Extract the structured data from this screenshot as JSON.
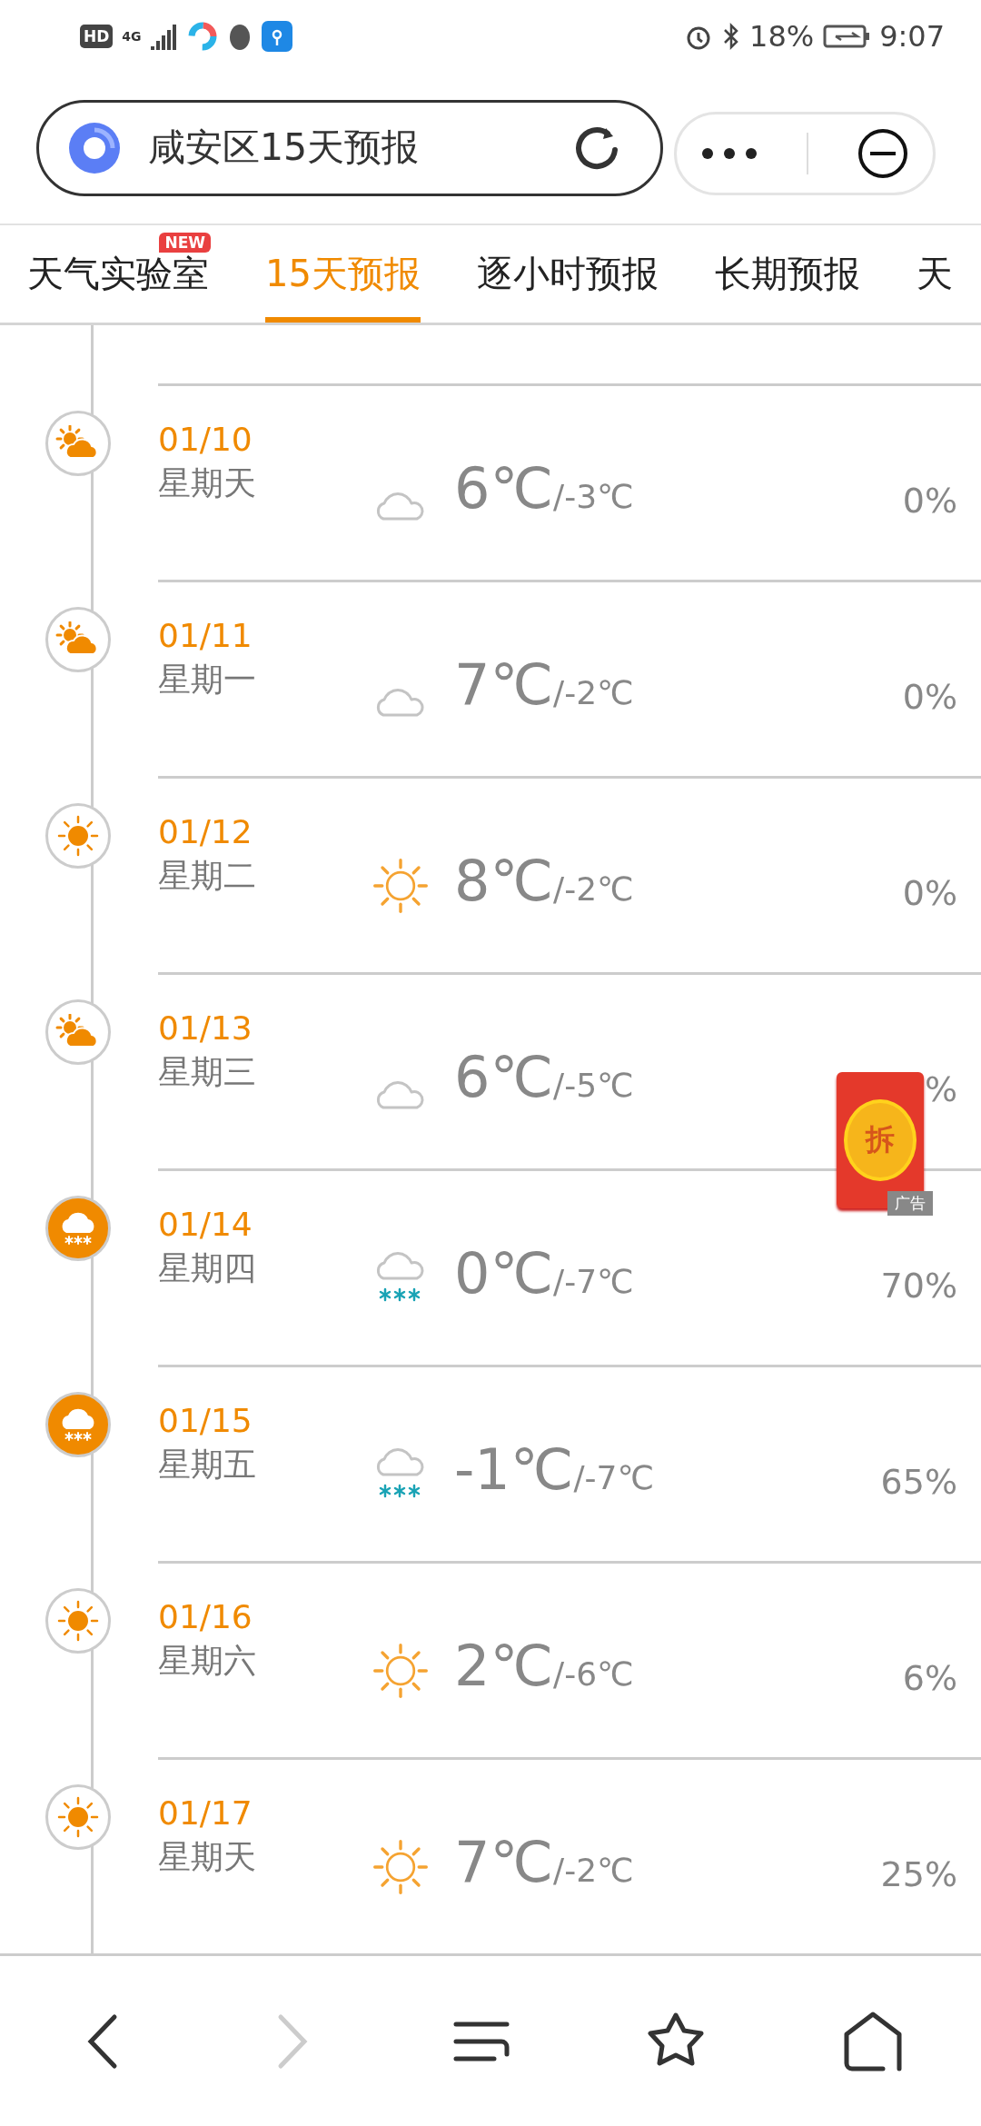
{
  "status_bar": {
    "hd": "HD",
    "network": "4G",
    "battery": "18%",
    "time": "9:07"
  },
  "header": {
    "title": "咸安区15天预报"
  },
  "tabs": [
    {
      "label": "天气实验室",
      "selected": false,
      "badge": "NEW"
    },
    {
      "label": "15天预报",
      "selected": true
    },
    {
      "label": "逐小时预报",
      "selected": false
    },
    {
      "label": "长期预报",
      "selected": false
    },
    {
      "label": "天",
      "selected": false
    }
  ],
  "days": [
    {
      "date": "01/10",
      "weekday": "星期天",
      "kind": "partly_cloudy",
      "high": "6℃",
      "low": "/-3℃",
      "precip": "0%"
    },
    {
      "date": "01/11",
      "weekday": "星期一",
      "kind": "partly_cloudy",
      "high": "7℃",
      "low": "/-2℃",
      "precip": "0%"
    },
    {
      "date": "01/12",
      "weekday": "星期二",
      "kind": "sunny",
      "high": "8℃",
      "low": "/-2℃",
      "precip": "0%"
    },
    {
      "date": "01/13",
      "weekday": "星期三",
      "kind": "partly_cloudy",
      "high": "6℃",
      "low": "/-5℃",
      "precip": "%"
    },
    {
      "date": "01/14",
      "weekday": "星期四",
      "kind": "snow",
      "high": "0℃",
      "low": "/-7℃",
      "precip": "70%"
    },
    {
      "date": "01/15",
      "weekday": "星期五",
      "kind": "snow",
      "high": "-1℃",
      "low": "/-7℃",
      "precip": "65%"
    },
    {
      "date": "01/16",
      "weekday": "星期六",
      "kind": "sunny",
      "high": "2℃",
      "low": "/-6℃",
      "precip": "6%"
    },
    {
      "date": "01/17",
      "weekday": "星期天",
      "kind": "sunny",
      "high": "7℃",
      "low": "/-2℃",
      "precip": "25%"
    }
  ],
  "ad": {
    "glyph": "拆",
    "label": "广告"
  }
}
